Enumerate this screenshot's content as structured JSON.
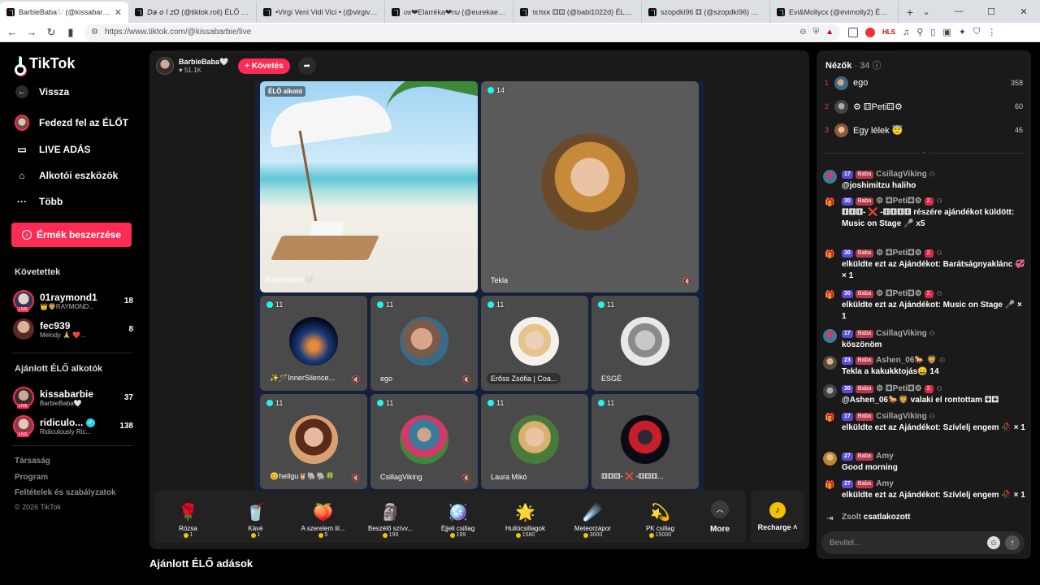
{
  "browser": {
    "tabs": [
      {
        "title": "BarbieBaba♡ (@kissabarbie)",
        "active": true
      },
      {
        "title": "𝘋𝘢 𝘰 𝘭 𝘻𝘖 (@tiktok.roli) ÉLŐ adás"
      },
      {
        "title": "•Virgi Veni Vidi Vici • (@virgivenivici)"
      },
      {
        "title": "𝑜𝑠❤Elarréka❤𝑛𝑢 (@eurekaeureka)"
      },
      {
        "title": "τεπεκ ⚃⚃ (@babi1022d) ÉLŐ adás"
      },
      {
        "title": "szopdki96 ⚃ (@szopdki96) ÉLŐ adás"
      },
      {
        "title": "Evi&Mollycx (@evimolly2) ÉLŐ adás"
      }
    ],
    "new_tab": "+",
    "url": "https://www.tiktok.com/@kissabarbie/live"
  },
  "sidebar": {
    "logo": "TikTok",
    "back": "Vissza",
    "nav": [
      {
        "label": "Fedezd fel az ÉLŐT",
        "icon": "live-avatar-icon"
      },
      {
        "label": "LIVE ADÁS",
        "icon": "camera-icon"
      },
      {
        "label": "Alkotói eszközök",
        "icon": "house-icon"
      },
      {
        "label": "Több",
        "icon": "more-dots-icon"
      }
    ],
    "coins_button": "Érmék beszerzése",
    "following_title": "Követettek",
    "following": [
      {
        "name": "01raymond1",
        "sub": "👑🦁RAYMOND...",
        "count": "18"
      },
      {
        "name": "fec939",
        "sub": "Melody 🙏 ❤️...",
        "count": "8"
      }
    ],
    "recommended_title": "Ajánlott ÉLŐ alkotók",
    "recommended": [
      {
        "name": "kissabarbie",
        "sub": "BarbieBaba🤍",
        "count": "37"
      },
      {
        "name": "ridiculo...",
        "sub": "Ridiculously Ric...",
        "count": "138"
      }
    ],
    "footer": [
      "Társaság",
      "Program",
      "Feltételek és szabályzatok",
      "© 2026 TikTok"
    ]
  },
  "host": {
    "name": "BarbieBaba🤍",
    "likes": "51.1K",
    "follow": "+ Követés"
  },
  "tiles": {
    "main": {
      "badge": "ÉLŐ alkotó",
      "label": "BarbieBaba🤍"
    },
    "tekla": {
      "count": "14",
      "label": "Tekla"
    },
    "guests": [
      {
        "count": "11",
        "label": "✨🪄InnerSilence..."
      },
      {
        "count": "11",
        "label": "ego"
      },
      {
        "count": "11",
        "label": "Erőss Zsófia | Coa..."
      },
      {
        "count": "11",
        "label": "ESGÉ"
      },
      {
        "count": "11",
        "label": "😊hellgu🦉🐘🐘🍀"
      },
      {
        "count": "11",
        "label": "CsillagViking"
      },
      {
        "count": "11",
        "label": "Laura Mikó"
      },
      {
        "count": "11",
        "label": "⚅⚅⚅- ❌ -⚅⚅⚅..."
      }
    ]
  },
  "gifts": [
    {
      "name": "Rózsa",
      "price": "1",
      "icon": "🌹"
    },
    {
      "name": "Kávé",
      "price": "1",
      "icon": "🥤"
    },
    {
      "name": "A szerelem lil...",
      "price": "5",
      "icon": "🍑"
    },
    {
      "name": "Beszélő szívv...",
      "price": "199",
      "icon": "🗿"
    },
    {
      "name": "Éjjeli csillag",
      "price": "199",
      "icon": "🪩"
    },
    {
      "name": "Hullócsillagok",
      "price": "1580",
      "icon": "🌟"
    },
    {
      "name": "Meteorzápor",
      "price": "3000",
      "icon": "☄️"
    },
    {
      "name": "PK csillag",
      "price": "15000",
      "icon": "💫"
    }
  ],
  "more": "More",
  "recharge": "Recharge",
  "recommended_lives_title": "Ajánlott ÉLŐ adások",
  "viewers": {
    "title": "Nézők",
    "count": "· 34",
    "list": [
      {
        "rank": "1",
        "name": "ego",
        "score": "358"
      },
      {
        "rank": "2",
        "name": "⚙ ⚃Peti⚃⚙",
        "score": "60"
      },
      {
        "rank": "3",
        "name": "Egy lélek 😇",
        "score": "46"
      }
    ]
  },
  "chat": [
    {
      "lv": "17",
      "fan": "Baba",
      "user": "CsillagViking",
      "text": "@joshimitzu haliho",
      "type": "user"
    },
    {
      "lv": "30",
      "fan": "Baba",
      "user": "⚙ ⚃Peti⚃⚙",
      "rank": "2.",
      "text": "⚅⚅⚅- ❌ -⚅⚅⚅⚅ részére ajándékot küldött: Music on Stage 🎤 x5",
      "type": "gift"
    },
    {
      "lv": "30",
      "fan": "Baba",
      "user": "⚙ ⚃Peti⚃⚙",
      "rank": "2.",
      "text": "elküldte ezt az Ajándékot: Barátságnyaklánc 💞 × 1",
      "type": "gift"
    },
    {
      "lv": "30",
      "fan": "Baba",
      "user": "⚙ ⚃Peti⚃⚙",
      "rank": "2.",
      "text": "elküldte ezt az Ajándékot: Music on Stage 🎤 × 1",
      "type": "gift"
    },
    {
      "lv": "17",
      "fan": "Baba",
      "user": "CsillagViking",
      "text": "köszönöm",
      "type": "user"
    },
    {
      "lv": "23",
      "fan": "Baba",
      "user": "Ashen_06🐎 🦁",
      "text": "Tekla a kakukktojás😄 14",
      "type": "user"
    },
    {
      "lv": "30",
      "fan": "Baba",
      "user": "⚙ ⚃Peti⚃⚙",
      "rank": "2.",
      "text": "@Ashen_06🐎🦁 valaki el rontottam ⚃⚃",
      "type": "user"
    },
    {
      "lv": "17",
      "fan": "Baba",
      "user": "CsillagViking",
      "text": "elküldte ezt az Ajándékot: Szívlelj engem 🥀 × 1",
      "type": "gift"
    },
    {
      "lv": "27",
      "fan": "Baba",
      "user": "Amy",
      "text": "Good morning",
      "type": "user"
    },
    {
      "lv": "27",
      "fan": "Baba",
      "user": "Amy",
      "text": "elküldte ezt az Ajándékot: Szívlelj engem 🥀 × 1",
      "type": "gift"
    }
  ],
  "joined": {
    "user": "Zsolt",
    "text": "csatlakozott"
  },
  "input_placeholder": "Bevitel..."
}
